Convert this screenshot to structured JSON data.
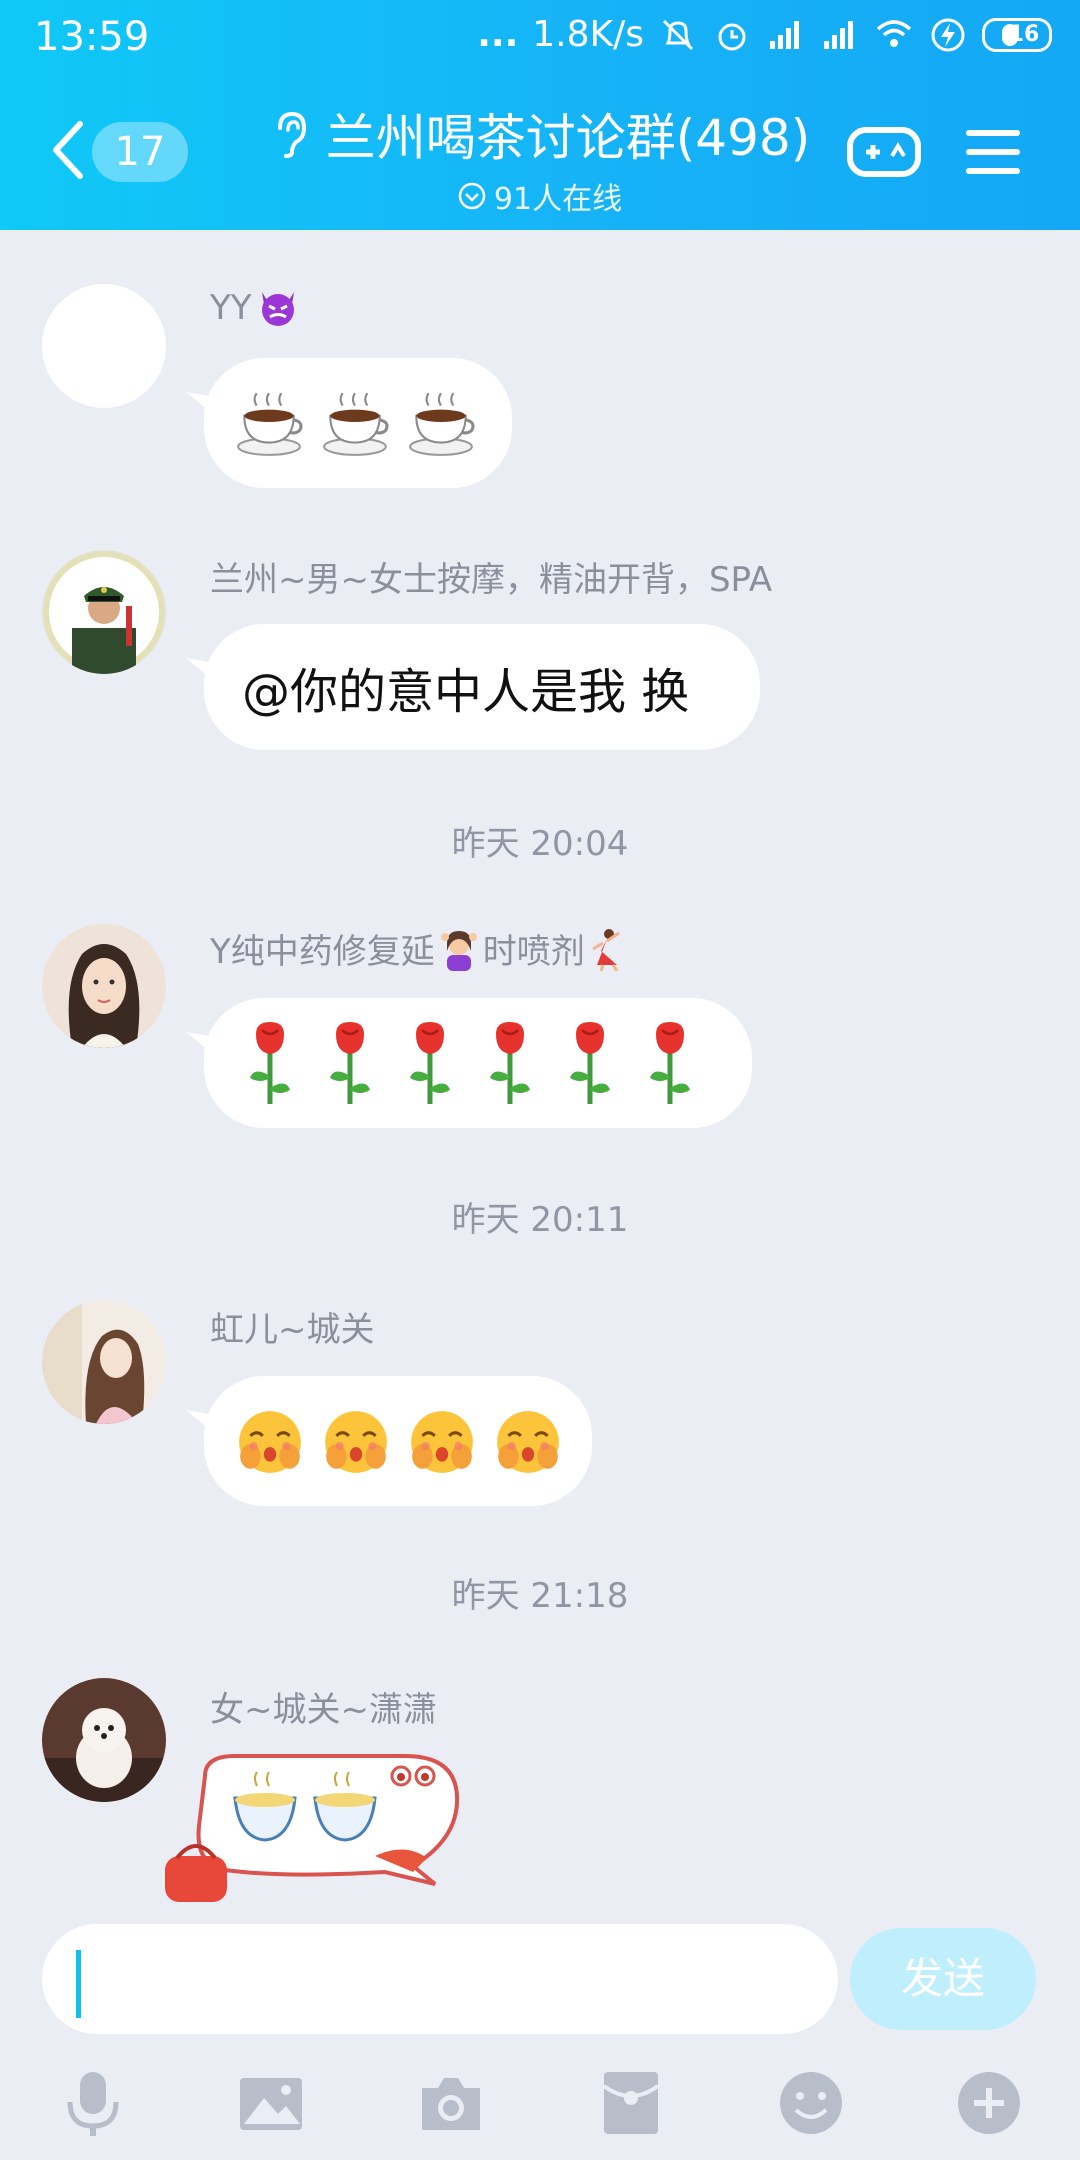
{
  "status_bar": {
    "time": "13:59",
    "dots": "...",
    "speed": "1.8K/s",
    "battery": "16"
  },
  "header": {
    "unread_count": "17",
    "group_title": "兰州喝茶讨论群(498)",
    "online_text": "91人在线",
    "accent": "#13b4f6"
  },
  "messages": [
    {
      "nickname": "YY",
      "nick_icon": "devil-emoji-icon",
      "content": "coffee x3"
    },
    {
      "nickname": "兰州~男~女士按摩，精油开背，SPA",
      "text": "@你的意中人是我 换"
    },
    {
      "time": "昨天 20:04"
    },
    {
      "nickname_part1": "Y纯中药修复延",
      "nickname_part2": "时喷剂",
      "content": "rose x6"
    },
    {
      "time": "昨天 20:11"
    },
    {
      "nickname": "虹儿~城关",
      "content": "shy-face x4"
    },
    {
      "time": "昨天 21:18"
    },
    {
      "nickname": "女~城关~潇潇",
      "content": "tea-bowls sticker"
    }
  ],
  "input": {
    "placeholder": "",
    "send_label": "发送"
  },
  "toolbar": [
    "mic-icon",
    "image-icon",
    "camera-icon",
    "red-packet-icon",
    "emoji-icon",
    "plus-icon"
  ]
}
